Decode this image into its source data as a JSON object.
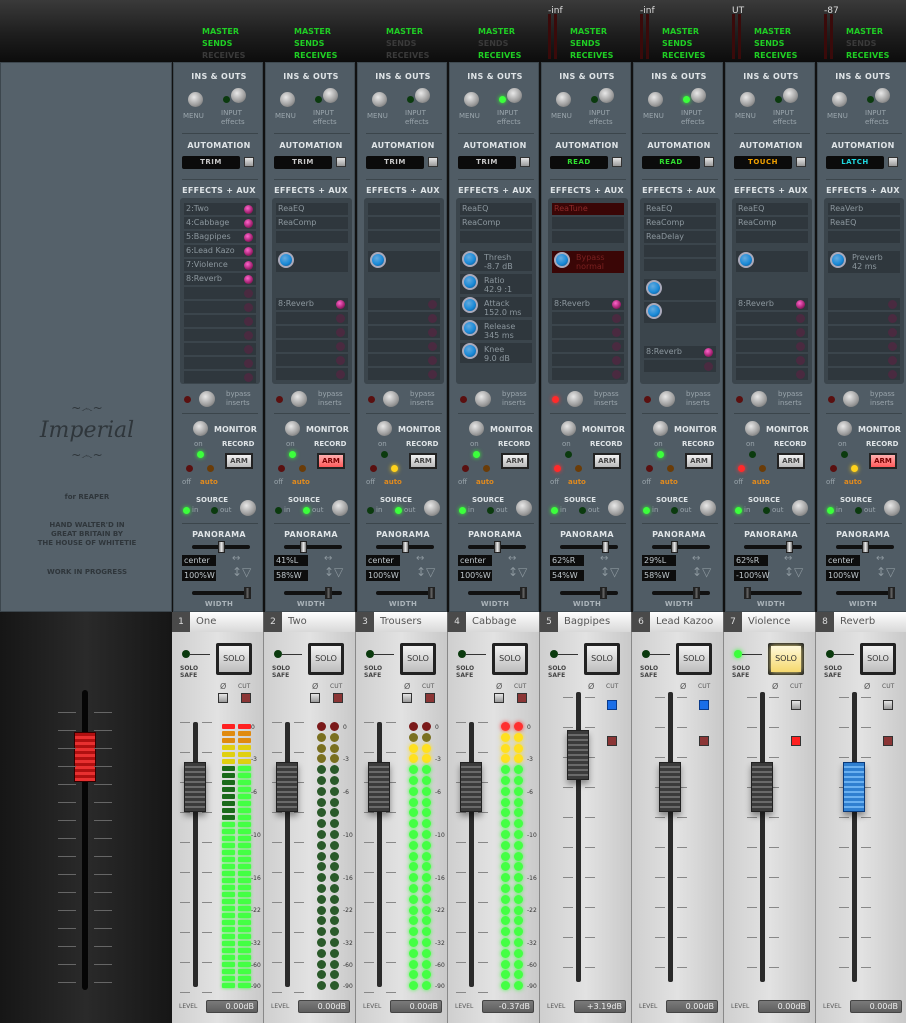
{
  "brand": {
    "logo": "Imperial",
    "for": "for REAPER",
    "credit": [
      "HAND WALTER'D IN",
      "GREAT BRITAIN BY",
      "THE HOUSE OF WHITETIE"
    ],
    "status": "WORK IN PROGRESS"
  },
  "labels": {
    "ins_outs": "INS & OUTS",
    "menu": "MENU",
    "input": "INPUT",
    "effects": "effects",
    "automation": "AUTOMATION",
    "fx_aux": "EFFECTS + AUX",
    "bypass": "bypass",
    "inserts": "inserts",
    "monitor": "MONITOR",
    "on": "on",
    "off": "off",
    "auto": "auto",
    "record": "RECORD",
    "arm": "ARM",
    "source": "SOURCE",
    "in": "in",
    "out": "out",
    "panorama": "PANORAMA",
    "width": "WIDTH",
    "solo": "SOLO",
    "solo_safe_1": "SOLO",
    "solo_safe_2": "SAFE",
    "phase": "Ø",
    "cut": "CUT",
    "level": "LEVEL",
    "master": "MASTER",
    "sends": "SENDS",
    "receives": "RECEIVES"
  },
  "colors": {
    "green_on": "#1fcf24",
    "green_off": "#3a3a3a",
    "arm_on": "#ff6b6b",
    "phase_on": "#1a6ee8",
    "touch": "#f0a000",
    "latch": "#20d8e0",
    "read": "#30e030",
    "trim": "#c8c8c8"
  },
  "meter_scale": [
    "0",
    "-3",
    "-6",
    "-10",
    "-16",
    "-22",
    "-32",
    "-60",
    "-90"
  ],
  "channels": [
    {
      "num": "1",
      "name": "One",
      "peak": "",
      "master": true,
      "sends": true,
      "receives": false,
      "input_fx": false,
      "automation": "TRIM",
      "fx": [],
      "params": [],
      "knob_slots": 0,
      "send_list": [
        "2:Two",
        "4:Cabbage",
        "5:Bagpipes",
        "6:Lead Kazo",
        "7:Violence",
        "8:Reverb"
      ],
      "bypass": false,
      "monitor": "on",
      "arm": false,
      "source": "in",
      "pan": "center",
      "width": "100%W",
      "pan_pos": 0.5,
      "width_pos": 1.0,
      "solo": false,
      "phase": false,
      "cut_on": false,
      "fader_db": 0,
      "level": "0.00dB",
      "meter": "bar",
      "meter_db": 0
    },
    {
      "num": "2",
      "name": "Two",
      "peak": "",
      "master": true,
      "sends": true,
      "receives": true,
      "input_fx": false,
      "automation": "TRIM",
      "fx": [
        "ReaEQ",
        "ReaComp"
      ],
      "params": [],
      "knob_slots": 1,
      "send_list": [
        "8:Reverb"
      ],
      "bypass": false,
      "monitor": "on",
      "arm": true,
      "source": "out",
      "pan": "41%L",
      "width": "58%W",
      "pan_pos": 0.3,
      "width_pos": 0.79,
      "solo": false,
      "phase": false,
      "cut_on": false,
      "fader_db": 0,
      "level": "0.00dB",
      "meter": "dot",
      "meter_db": null
    },
    {
      "num": "3",
      "name": "Trousers",
      "peak": "",
      "master": true,
      "sends": false,
      "receives": false,
      "input_fx": false,
      "automation": "TRIM",
      "fx": [],
      "params": [],
      "knob_slots": 1,
      "send_list": [],
      "bypass": false,
      "monitor": "auto",
      "arm": false,
      "source": "out",
      "pan": "center",
      "width": "100%W",
      "pan_pos": 0.5,
      "width_pos": 1.0,
      "solo": false,
      "phase": false,
      "cut_on": false,
      "fader_db": 0,
      "level": "0.00dB",
      "meter": "dot",
      "meter_db": -2
    },
    {
      "num": "4",
      "name": "Cabbage",
      "peak": "",
      "master": true,
      "sends": false,
      "receives": true,
      "input_fx": true,
      "automation": "TRIM",
      "fx": [
        "ReaEQ",
        "ReaComp"
      ],
      "params": [
        [
          "Thresh",
          "-8.7 dB"
        ],
        [
          "Ratio",
          "42.9 :1"
        ],
        [
          "Attack",
          "152.0 ms"
        ],
        [
          "Release",
          "345 ms"
        ],
        [
          "Knee",
          "9.0 dB"
        ]
      ],
      "knob_slots": 0,
      "send_list": [],
      "bypass": false,
      "monitor": "on",
      "arm": false,
      "source": "in",
      "pan": "center",
      "width": "100%W",
      "pan_pos": 0.5,
      "width_pos": 1.0,
      "solo": false,
      "phase": false,
      "cut_on": false,
      "fader_db": -0.37,
      "level": "-0.37dB",
      "meter": "dot",
      "meter_db": 0
    },
    {
      "num": "5",
      "name": "Bagpipes",
      "peak": "-inf",
      "master": true,
      "sends": true,
      "receives": true,
      "input_fx": false,
      "automation": "READ",
      "fx": [
        "ReaTune"
      ],
      "fx_bypassed": true,
      "params": [
        [
          "Bypass",
          "normal"
        ]
      ],
      "knob_slots": 0,
      "send_list": [
        "8:Reverb"
      ],
      "bypass": true,
      "monitor": "off",
      "arm": false,
      "source": "in",
      "pan": "62%R",
      "width": "54%W",
      "pan_pos": 0.81,
      "width_pos": 0.77,
      "solo": false,
      "phase": true,
      "cut_on": false,
      "fader_db": 3.19,
      "level": "+3.19dB",
      "meter": "none"
    },
    {
      "num": "6",
      "name": "Lead Kazoo",
      "peak": "-inf",
      "master": true,
      "sends": true,
      "receives": true,
      "input_fx": true,
      "automation": "READ",
      "fx": [
        "ReaEQ",
        "ReaComp",
        "ReaDelay"
      ],
      "params": [],
      "knob_slots": 2,
      "send_list": [
        "8:Reverb"
      ],
      "send_offset": true,
      "bypass": false,
      "monitor": "on",
      "arm": false,
      "source": "in",
      "pan": "29%L",
      "width": "58%W",
      "pan_pos": 0.36,
      "width_pos": 0.79,
      "solo": false,
      "phase": true,
      "cut_on": false,
      "fader_db": 0,
      "level": "0.00dB",
      "meter": "none"
    },
    {
      "num": "7",
      "name": "Violence",
      "peak": "UT",
      "master": true,
      "sends": true,
      "receives": true,
      "input_fx": false,
      "automation": "TOUCH",
      "fx": [
        "ReaEQ",
        "ReaComp"
      ],
      "params": [],
      "knob_slots": 1,
      "send_list": [
        "8:Reverb"
      ],
      "bypass": false,
      "monitor": "off",
      "arm": false,
      "source": "in",
      "pan": "62%R",
      "width": "-100%W",
      "pan_pos": 0.81,
      "width_pos": 0.0,
      "solo": true,
      "phase": false,
      "cut_on": true,
      "fader_db": 0,
      "level": "0.00dB",
      "meter": "none"
    },
    {
      "num": "8",
      "name": "Reverb",
      "peak": "-87",
      "master": true,
      "sends": false,
      "receives": true,
      "input_fx": false,
      "automation": "LATCH",
      "fx": [
        "ReaVerb",
        "ReaEQ"
      ],
      "params": [
        [
          "Preverb",
          "42 ms"
        ]
      ],
      "knob_slots": 0,
      "send_list": [],
      "bypass": false,
      "monitor": "auto",
      "arm": true,
      "source": "in",
      "pan": "center",
      "width": "100%W",
      "pan_pos": 0.5,
      "width_pos": 1.0,
      "solo": false,
      "phase": false,
      "cut_on": false,
      "fader_db": 0,
      "fader_color": "blue",
      "level": "0.00dB",
      "meter": "none"
    }
  ]
}
